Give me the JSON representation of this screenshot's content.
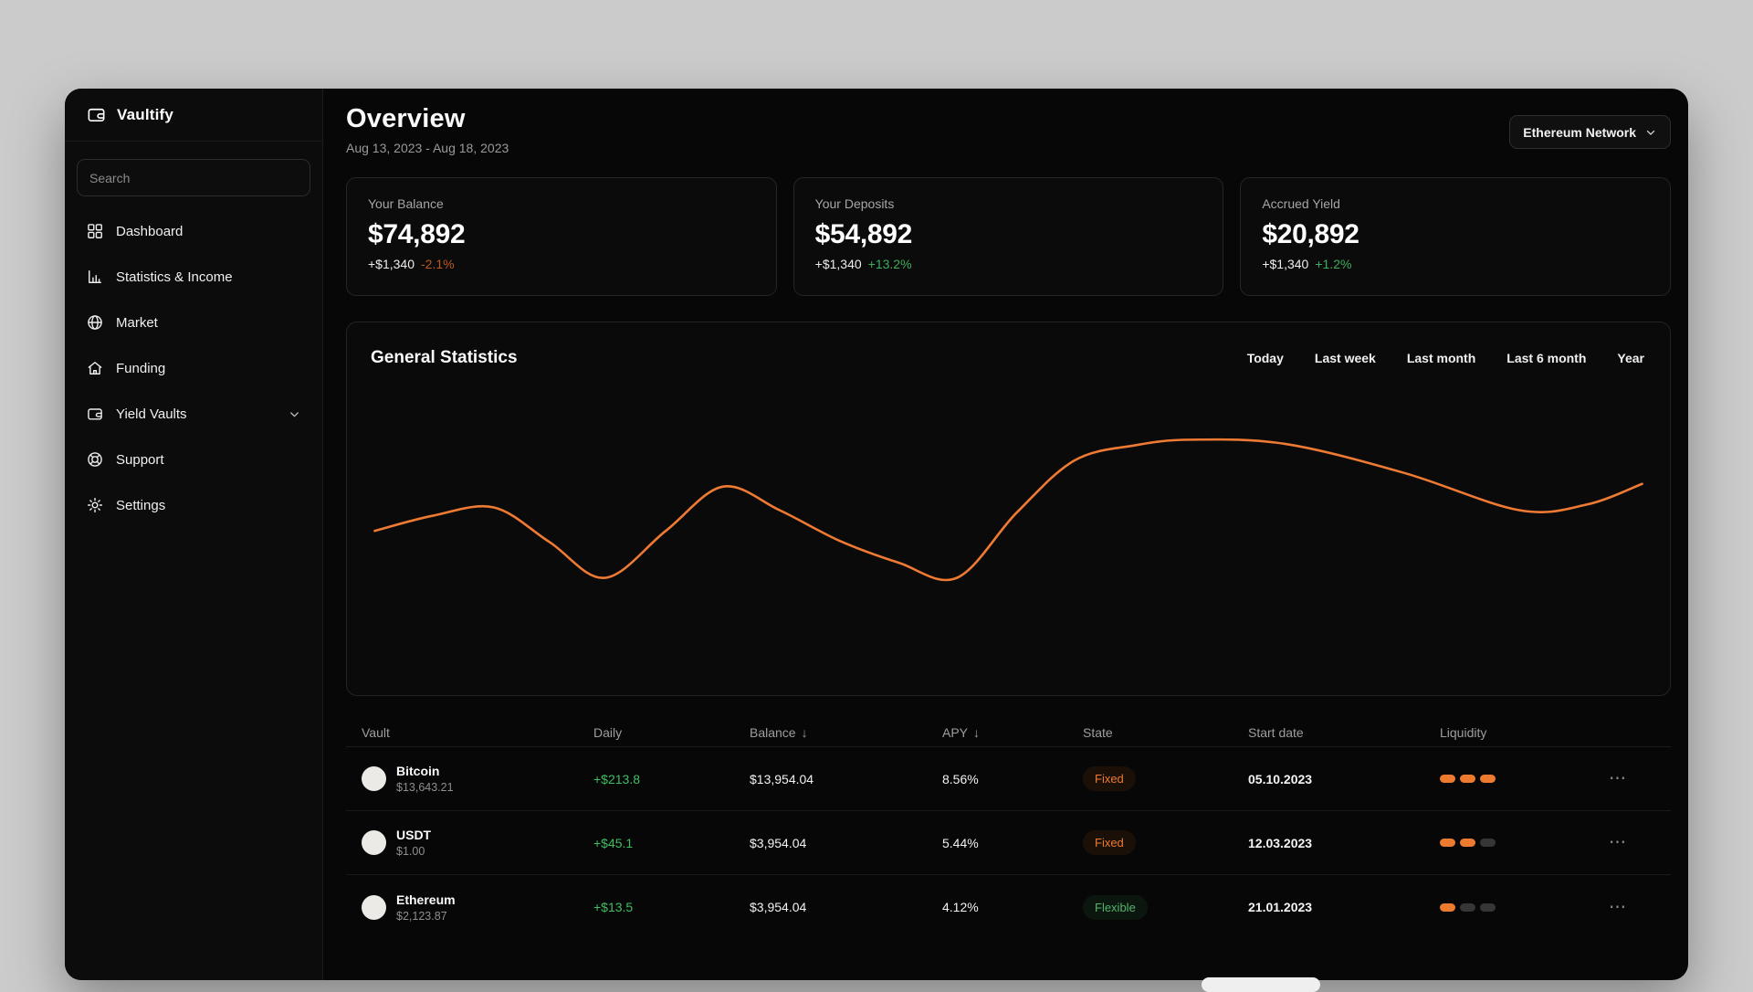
{
  "theme": {
    "accent_orange": "#ed7b2f",
    "positive_green": "#3fbf62",
    "negative_orange": "#bf5b1d",
    "window_bg": "#070707",
    "canvas_bg": "#cbcbcb"
  },
  "sidebar": {
    "logo": {
      "name": "Vaultify",
      "icon": "wallet-icon"
    },
    "search": {
      "placeholder": "Search"
    },
    "items": [
      {
        "label": "Dashboard",
        "icon": "dashboard-grid-icon"
      },
      {
        "label": "Statistics & Income",
        "icon": "bar-chart-icon"
      },
      {
        "label": "Market",
        "icon": "globe-icon"
      },
      {
        "label": "Funding",
        "icon": "home-icon"
      },
      {
        "label": "Yield Vaults",
        "icon": "vault-wallet-icon",
        "has_submenu": true
      },
      {
        "label": "Support",
        "icon": "lifebuoy-icon"
      },
      {
        "label": "Settings",
        "icon": "gear-icon"
      }
    ]
  },
  "header": {
    "title": "Overview",
    "date_range": "Aug 13, 2023 - Aug 18, 2023",
    "network_selector": {
      "label": "Ethereum Network",
      "icon": "chevron-down-icon"
    }
  },
  "stats_cards": [
    {
      "label": "Your Balance",
      "value": "$74,892",
      "change": "+$1,340",
      "change_pct": "-2.1%",
      "change_pct_color": "#bf5b1d"
    },
    {
      "label": "Your Deposits",
      "value": "$54,892",
      "change": "+$1,340",
      "change_pct": "+13.2%",
      "change_pct_color": "#3fae5d"
    },
    {
      "label": "Accrued Yield",
      "value": "$20,892",
      "change": "+$1,340",
      "change_pct": "+1.2%",
      "change_pct_color": "#3fae5d"
    }
  ],
  "statistics_panel": {
    "title": "General Statistics",
    "filters": [
      "Today",
      "Last week",
      "Last month",
      "Last 6 month",
      "Year"
    ]
  },
  "chart_data": {
    "type": "line",
    "title": "General Statistics",
    "x_range_label": "Aug 13, 2023 - Aug 18, 2023",
    "grid": false,
    "legend": false,
    "axes_visible": false,
    "series": [
      {
        "name": "portfolio-value",
        "color": "#ee7a33",
        "points_normalized": [
          [
            0.021,
            0.34
          ],
          [
            0.065,
            0.45
          ],
          [
            0.111,
            0.51
          ],
          [
            0.153,
            0.26
          ],
          [
            0.195,
            0.0
          ],
          [
            0.241,
            0.34
          ],
          [
            0.284,
            0.66
          ],
          [
            0.327,
            0.49
          ],
          [
            0.372,
            0.27
          ],
          [
            0.417,
            0.11
          ],
          [
            0.461,
            0.0
          ],
          [
            0.506,
            0.47
          ],
          [
            0.55,
            0.85
          ],
          [
            0.596,
            0.96
          ],
          [
            0.638,
            1.0
          ],
          [
            0.709,
            0.97
          ],
          [
            0.799,
            0.76
          ],
          [
            0.886,
            0.49
          ],
          [
            0.937,
            0.53
          ],
          [
            0.979,
            0.68
          ]
        ]
      }
    ]
  },
  "table": {
    "columns": [
      {
        "label": "Vault"
      },
      {
        "label": "Daily"
      },
      {
        "label": "Balance",
        "sort": "desc"
      },
      {
        "label": "APY",
        "sort": "desc"
      },
      {
        "label": "State"
      },
      {
        "label": "Start date"
      },
      {
        "label": "Liquidity"
      }
    ],
    "sort_icon": "↓",
    "row_menu_icon": "⋯",
    "rows": [
      {
        "vault": "Bitcoin",
        "price": "$13,643.21",
        "daily": "+$213.8",
        "balance": "$13,954.04",
        "apy": "8.56%",
        "state": "Fixed",
        "start_date": "05.10.2023",
        "liquidity": {
          "active": 3,
          "total": 3
        }
      },
      {
        "vault": "USDT",
        "price": "$1.00",
        "daily": "+$45.1",
        "balance": "$3,954.04",
        "apy": "5.44%",
        "state": "Fixed",
        "start_date": "12.03.2023",
        "liquidity": {
          "active": 2,
          "total": 3
        }
      },
      {
        "vault": "Ethereum",
        "price": "$2,123.87",
        "daily": "+$13.5",
        "balance": "$3,954.04",
        "apy": "4.12%",
        "state": "Flexible",
        "start_date": "21.01.2023",
        "liquidity": {
          "active": 1,
          "total": 3
        }
      }
    ]
  }
}
